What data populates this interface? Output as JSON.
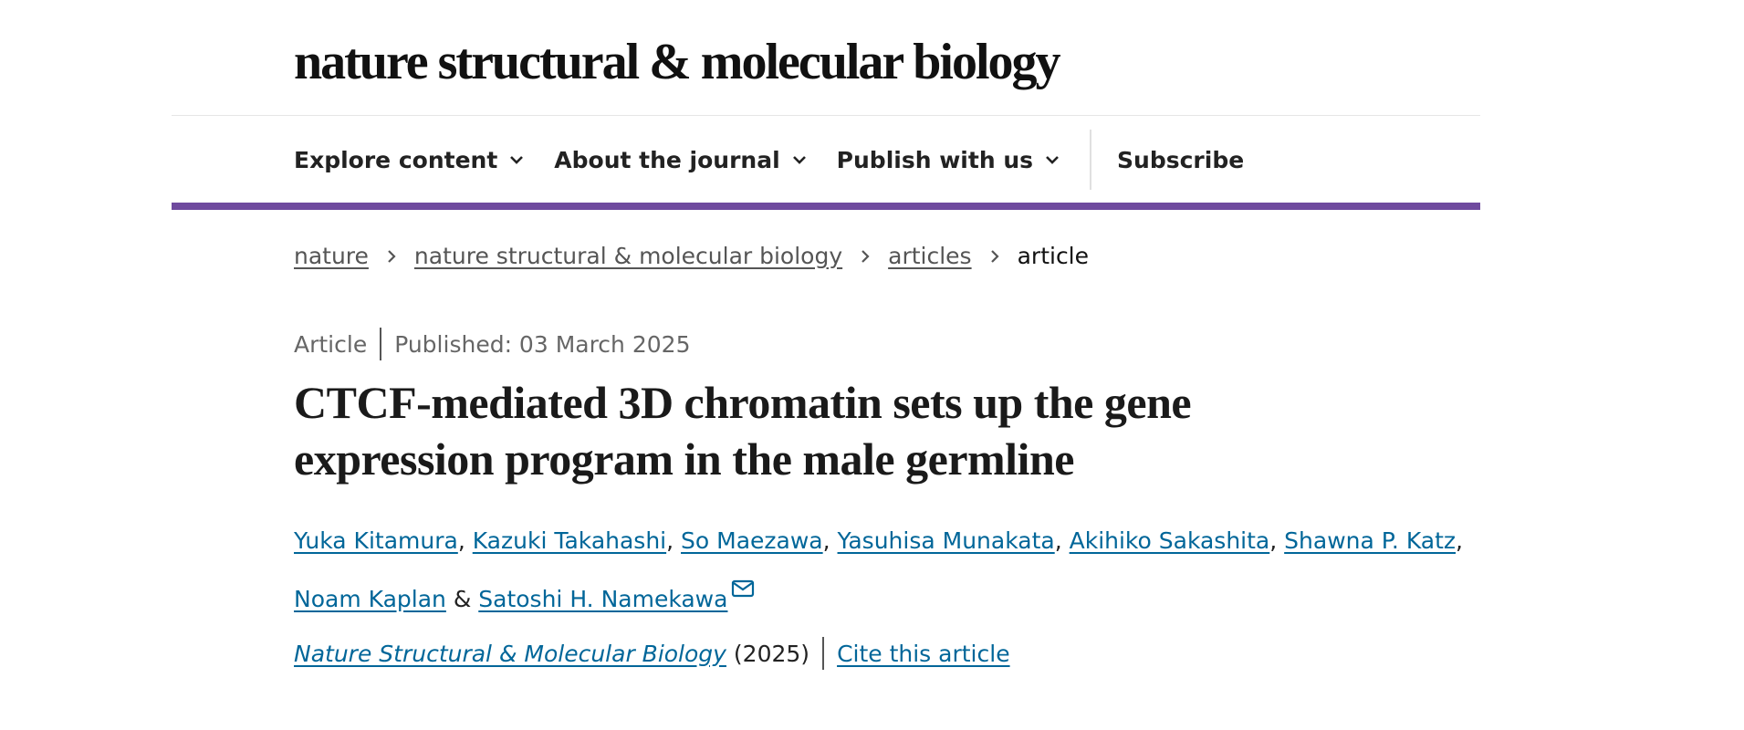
{
  "header": {
    "masthead": "nature structural & molecular biology"
  },
  "nav": {
    "items": [
      {
        "label": "Explore content",
        "icon": "chevron-down-icon"
      },
      {
        "label": "About the journal",
        "icon": "chevron-down-icon"
      },
      {
        "label": "Publish with us",
        "icon": "chevron-down-icon"
      }
    ],
    "subscribe": "Subscribe"
  },
  "colors": {
    "accent_bar": "#6f4a9e",
    "link": "#006699"
  },
  "breadcrumb": {
    "items": [
      "nature",
      "nature structural & molecular biology",
      "articles"
    ],
    "current": "article"
  },
  "article": {
    "type": "Article",
    "published": "Published: 03 March 2025",
    "title": "CTCF-mediated 3D chromatin sets up the gene expression program in the male germline",
    "authors": [
      "Yuka Kitamura",
      "Kazuki Takahashi",
      "So Maezawa",
      "Yasuhisa Munakata",
      "Akihiko Sakashita",
      "Shawna P. Katz",
      "Noam Kaplan",
      "Satoshi H. Namekawa"
    ],
    "separator_comma": ", ",
    "separator_amp": " & ",
    "journal": "Nature Structural & Molecular Biology",
    "year": "(2025)",
    "cite": "Cite this article"
  }
}
